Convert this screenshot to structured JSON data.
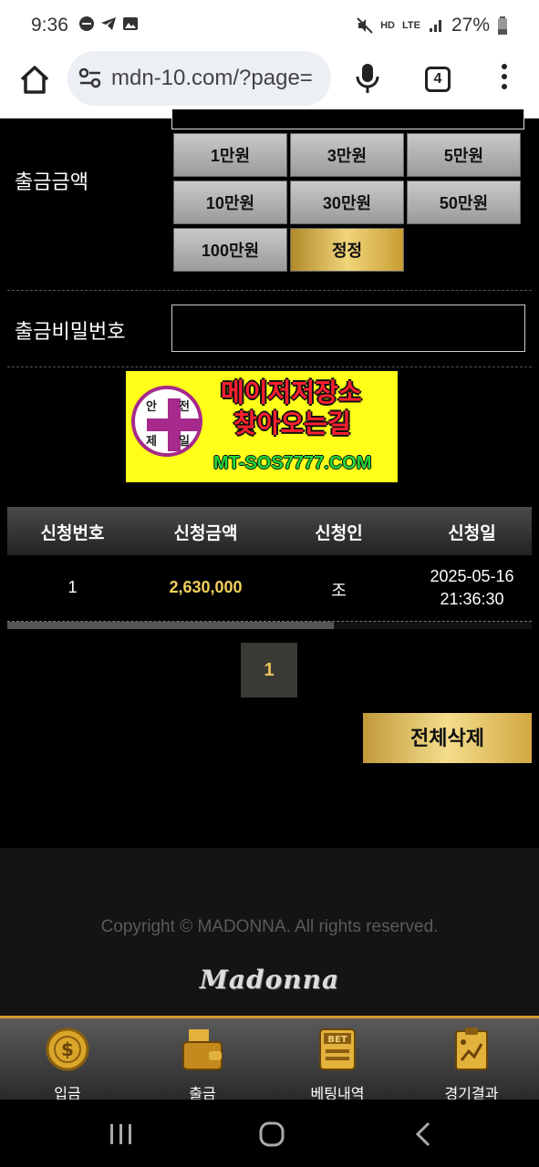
{
  "status_bar": {
    "time": "9:36",
    "battery": "27%",
    "network": "LTE",
    "hd": "HD"
  },
  "browser": {
    "url": "mdn-10.com/?page=",
    "tabs_count": "4"
  },
  "withdraw": {
    "amount_label": "출금금액",
    "amount_buttons": [
      "1만원",
      "3만원",
      "5만원",
      "10만원",
      "30만원",
      "50만원",
      "100만원",
      "정정"
    ],
    "password_label": "출금비밀번호",
    "password_value": ""
  },
  "banner": {
    "circle_chars": [
      "안",
      "전",
      "제",
      "일"
    ],
    "line1": "메이저저장소",
    "line2": "찾아오는길",
    "domain": "MT-SOS7777.COM"
  },
  "table": {
    "headers": [
      "신청번호",
      "신청금액",
      "신청인",
      "신청일"
    ],
    "rows": [
      {
        "no": "1",
        "amount": "2,630,000",
        "applicant": "조",
        "date": "2025-05-16",
        "time": "21:36:30"
      }
    ]
  },
  "pagination": {
    "current": "1"
  },
  "delete_all_label": "전체삭제",
  "footer": {
    "copyright": "Copyright © MADONNA. All rights reserved.",
    "logo": "Madonna"
  },
  "bottom_nav": [
    "입금",
    "출금",
    "베팅내역",
    "경기결과"
  ],
  "colors": {
    "gold": "#f3cf5a",
    "accent_border": "#d39a2e",
    "banner_bg": "#ffff1a"
  }
}
